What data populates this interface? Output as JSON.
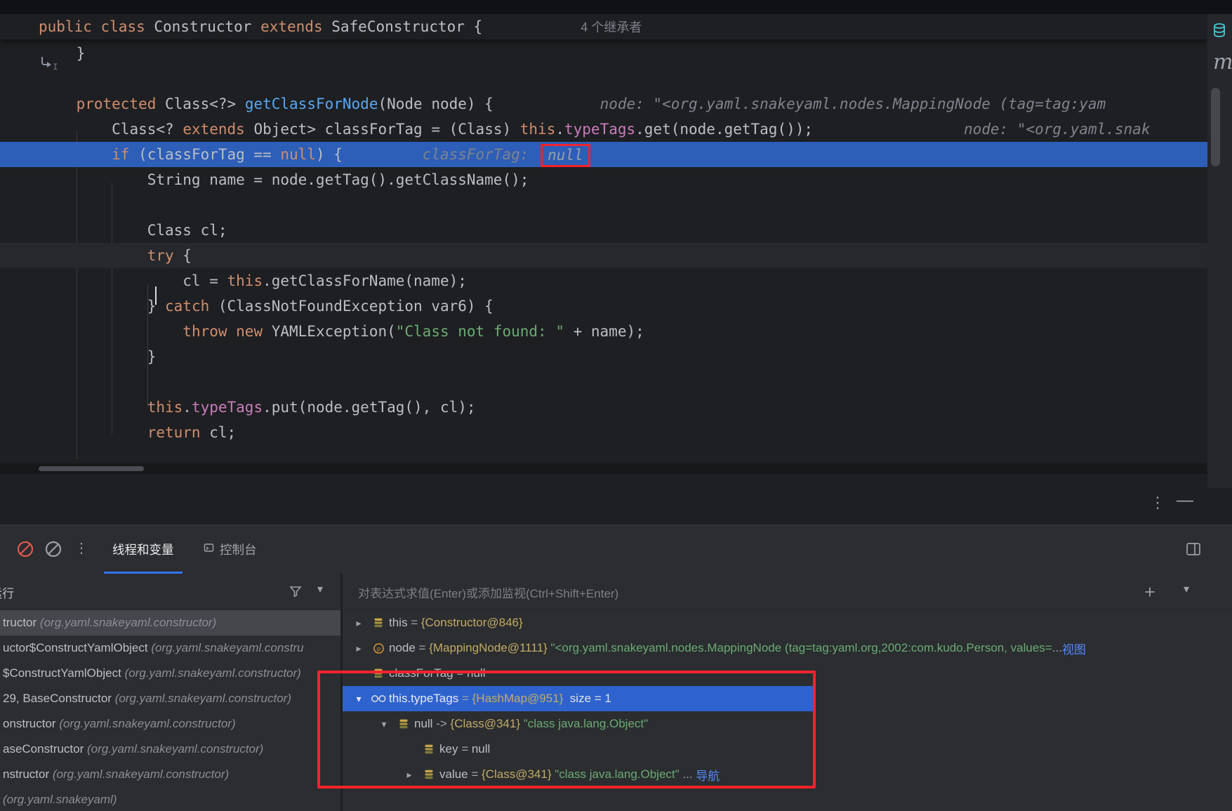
{
  "editor": {
    "sticky": {
      "tokens": [
        {
          "t": "public ",
          "c": "k"
        },
        {
          "t": "class ",
          "c": "k"
        },
        {
          "t": "Constructor ",
          "c": "p"
        },
        {
          "t": "extends ",
          "c": "k"
        },
        {
          "t": "SafeConstructor ",
          "c": "p"
        },
        {
          "t": "{",
          "c": "p"
        }
      ],
      "inheritors": "4 个继承者"
    },
    "lines": [
      {
        "cls": "",
        "tokens": [
          {
            "t": "    }",
            "c": "p"
          }
        ]
      },
      {
        "cls": "",
        "tokens": []
      },
      {
        "cls": "",
        "tokens": [
          {
            "t": "    ",
            "c": "p"
          },
          {
            "t": "protected ",
            "c": "k"
          },
          {
            "t": "Class<?> ",
            "c": "p"
          },
          {
            "t": "getClassForNode",
            "c": "m"
          },
          {
            "t": "(Node node) {",
            "c": "p"
          },
          {
            "t": "            ",
            "c": "p"
          },
          {
            "t": "node: \"<org.yaml.snakeyaml.nodes.MappingNode (tag=tag:yam",
            "c": "h"
          }
        ]
      },
      {
        "cls": "",
        "tokens": [
          {
            "t": "        ",
            "c": "p"
          },
          {
            "t": "Class<? ",
            "c": "p"
          },
          {
            "t": "extends ",
            "c": "k"
          },
          {
            "t": "Object> classForTag = (Class) ",
            "c": "p"
          },
          {
            "t": "this",
            "c": "k"
          },
          {
            "t": ".",
            "c": "p"
          },
          {
            "t": "typeTags",
            "c": "f"
          },
          {
            "t": ".get(node.getTag());",
            "c": "p"
          },
          {
            "t": "                 ",
            "c": "p"
          },
          {
            "t": "node: \"<org.yaml.snak",
            "c": "h"
          }
        ]
      },
      {
        "cls": "exec",
        "tokens": [
          {
            "t": "        ",
            "c": "p"
          },
          {
            "t": "if ",
            "c": "k"
          },
          {
            "t": "(classForTag == ",
            "c": "p"
          },
          {
            "t": "null",
            "c": "k"
          },
          {
            "t": ") {",
            "c": "p"
          },
          {
            "t": "         ",
            "c": "p"
          },
          {
            "t": "classForTag: ",
            "c": "h"
          },
          {
            "t": "null",
            "c": "hn"
          }
        ]
      },
      {
        "cls": "",
        "tokens": [
          {
            "t": "            String name = node.getTag().getClassName();",
            "c": "p"
          }
        ]
      },
      {
        "cls": "",
        "tokens": []
      },
      {
        "cls": "",
        "tokens": [
          {
            "t": "            Class cl;",
            "c": "p"
          }
        ]
      },
      {
        "cls": "caret",
        "tokens": [
          {
            "t": "            ",
            "c": "p"
          },
          {
            "t": "try ",
            "c": "k"
          },
          {
            "t": "{",
            "c": "p"
          }
        ]
      },
      {
        "cls": "",
        "tokens": [
          {
            "t": "                cl = ",
            "c": "p"
          },
          {
            "t": "this",
            "c": "k"
          },
          {
            "t": ".getClassForName(name);",
            "c": "p"
          }
        ]
      },
      {
        "cls": "",
        "tokens": [
          {
            "t": "            } ",
            "c": "p"
          },
          {
            "t": "catch ",
            "c": "k"
          },
          {
            "t": "(ClassNotFoundException var6) {",
            "c": "p"
          }
        ]
      },
      {
        "cls": "",
        "tokens": [
          {
            "t": "                ",
            "c": "p"
          },
          {
            "t": "throw ",
            "c": "k"
          },
          {
            "t": "new ",
            "c": "k"
          },
          {
            "t": "YAMLException(",
            "c": "p"
          },
          {
            "t": "\"Class not found: \"",
            "c": "s"
          },
          {
            "t": " + name);",
            "c": "p"
          }
        ]
      },
      {
        "cls": "",
        "tokens": [
          {
            "t": "            }",
            "c": "p"
          }
        ]
      },
      {
        "cls": "",
        "tokens": []
      },
      {
        "cls": "",
        "tokens": [
          {
            "t": "            ",
            "c": "p"
          },
          {
            "t": "this",
            "c": "k"
          },
          {
            "t": ".",
            "c": "p"
          },
          {
            "t": "typeTags",
            "c": "f"
          },
          {
            "t": ".put(node.getTag(), cl);",
            "c": "p"
          }
        ]
      },
      {
        "cls": "",
        "tokens": [
          {
            "t": "            ",
            "c": "p"
          },
          {
            "t": "return ",
            "c": "k"
          },
          {
            "t": "cl;",
            "c": "p"
          }
        ]
      }
    ]
  },
  "right_toolbar": {
    "maven_label": "m"
  },
  "debug": {
    "panel_tabs": [
      {
        "label": "线程和变量",
        "selected": true
      },
      {
        "label": "控制台",
        "selected": false
      }
    ],
    "frames_header": {
      "label": "运行"
    },
    "evaluate_placeholder": "对表达式求值(Enter)或添加监视(Ctrl+Shift+Enter)",
    "frames": [
      {
        "main": "tructor",
        "pkg": "(org.yaml.snakeyaml.constructor)",
        "selected": true
      },
      {
        "main": "uctor$ConstructYamlObject",
        "pkg": "(org.yaml.snakeyaml.constru",
        "selected": false
      },
      {
        "main": "$ConstructYamlObject",
        "pkg": "(org.yaml.snakeyaml.constructor)",
        "selected": false
      },
      {
        "main": "29, BaseConstructor",
        "pkg": "(org.yaml.snakeyaml.constructor)",
        "selected": false
      },
      {
        "main": "onstructor",
        "pkg": "(org.yaml.snakeyaml.constructor)",
        "selected": false
      },
      {
        "main": "aseConstructor",
        "pkg": "(org.yaml.snakeyaml.constructor)",
        "selected": false
      },
      {
        "main": "nstructor",
        "pkg": "(org.yaml.snakeyaml.constructor)",
        "selected": false
      },
      {
        "main": "",
        "pkg": "(org.yaml.snakeyaml)",
        "selected": false
      }
    ],
    "variables": [
      {
        "level": 0,
        "chevron": "closed",
        "icon": "variable",
        "selected": false,
        "parts": [
          {
            "t": "this",
            "c": "name"
          },
          {
            "t": " = ",
            "c": "eq"
          },
          {
            "t": "{Constructor@846}",
            "c": "val"
          }
        ]
      },
      {
        "level": 0,
        "chevron": "closed",
        "icon": "parameter",
        "selected": false,
        "parts": [
          {
            "t": "node",
            "c": "name"
          },
          {
            "t": " = ",
            "c": "eq"
          },
          {
            "t": "{MappingNode@1111} ",
            "c": "val"
          },
          {
            "t": "\"<org.yaml.snakeyaml.nodes.MappingNode (tag=tag:yaml.org,2002:com.kudo.Person, values=",
            "c": "str"
          },
          {
            "t": "...",
            "c": "eq"
          },
          {
            "t": "视图",
            "c": "link",
            "n": "view-link"
          }
        ]
      },
      {
        "level": 0,
        "chevron": "none",
        "icon": "variable",
        "selected": false,
        "parts": [
          {
            "t": "classForTag",
            "c": "name"
          },
          {
            "t": " = ",
            "c": "eq"
          },
          {
            "t": "null",
            "c": "name"
          }
        ]
      },
      {
        "level": 0,
        "chevron": "open",
        "icon": "watch",
        "selected": true,
        "parts": [
          {
            "t": "this.typeTags",
            "c": "name"
          },
          {
            "t": " = ",
            "c": "eq"
          },
          {
            "t": "{HashMap@951} ",
            "c": "val"
          },
          {
            "t": " size = 1",
            "c": "wht"
          }
        ]
      },
      {
        "level": 1,
        "chevron": "open",
        "icon": "variable",
        "selected": false,
        "parts": [
          {
            "t": "null",
            "c": "name"
          },
          {
            "t": " -> ",
            "c": "eq"
          },
          {
            "t": "{Class@341} ",
            "c": "val"
          },
          {
            "t": "\"class java.lang.Object\"",
            "c": "str"
          }
        ]
      },
      {
        "level": 2,
        "chevron": "none",
        "icon": "variable",
        "selected": false,
        "parts": [
          {
            "t": "key",
            "c": "name"
          },
          {
            "t": " = ",
            "c": "eq"
          },
          {
            "t": "null",
            "c": "name"
          }
        ]
      },
      {
        "level": 2,
        "chevron": "closed",
        "icon": "variable",
        "selected": false,
        "parts": [
          {
            "t": "value",
            "c": "name"
          },
          {
            "t": " = ",
            "c": "eq"
          },
          {
            "t": "{Class@341} ",
            "c": "val"
          },
          {
            "t": "\"class java.lang.Object\"",
            "c": "str"
          },
          {
            "t": " ... ",
            "c": "eq"
          },
          {
            "t": "导航",
            "c": "link",
            "n": "navigate-link"
          }
        ]
      }
    ]
  },
  "colors": {
    "accent_blue": "#3574F0",
    "execution_line_blue": "#2D5EB8",
    "selection_blue": "#2E63CE",
    "annotation_red": "#F5222D",
    "link_blue": "#548AF7",
    "keyword_orange": "#CF8E6D",
    "string_green": "#6AAB73",
    "field_purple": "#C77DBB",
    "method_blue": "#57A8F5"
  }
}
